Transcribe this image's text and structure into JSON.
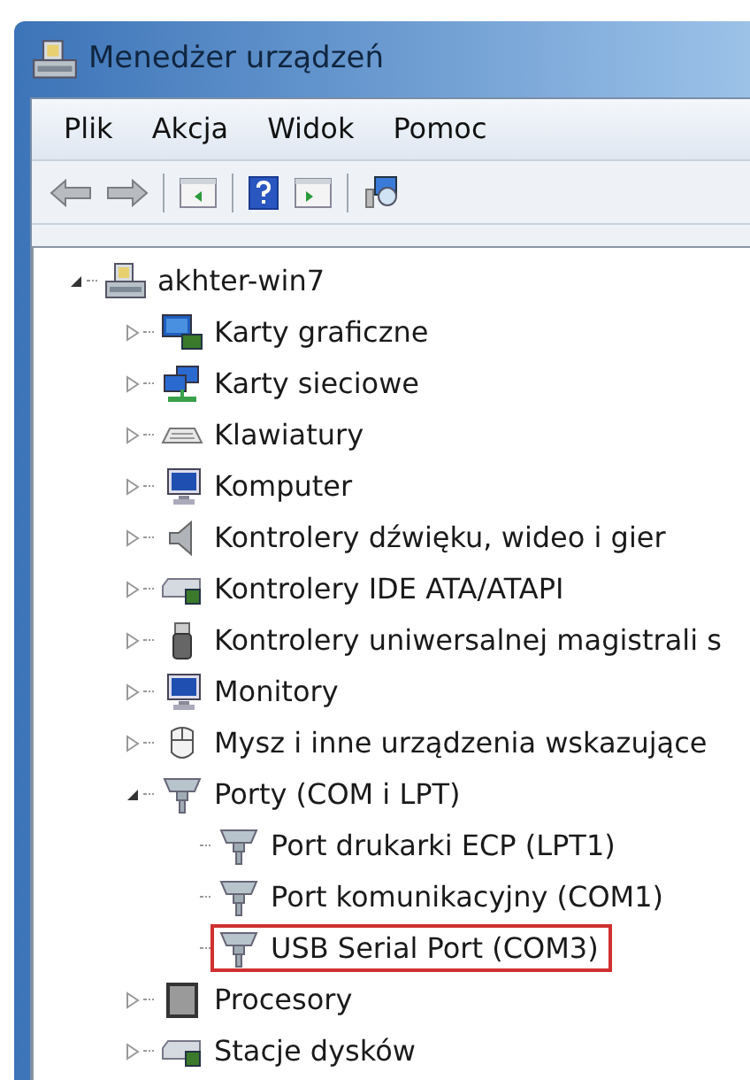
{
  "window": {
    "title": "Menedżer urządzeń"
  },
  "menu": [
    "Plik",
    "Akcja",
    "Widok",
    "Pomoc"
  ],
  "tree": [
    {
      "label": "akhter-win7",
      "kind": "computer",
      "expanded": true,
      "children": [
        {
          "label": "Karty graficzne",
          "kind": "display",
          "expanded": false
        },
        {
          "label": "Karty sieciowe",
          "kind": "network",
          "expanded": false
        },
        {
          "label": "Klawiatury",
          "kind": "keyboard",
          "expanded": false
        },
        {
          "label": "Komputer",
          "kind": "monitor",
          "expanded": false
        },
        {
          "label": "Kontrolery dźwięku, wideo i gier",
          "kind": "speaker",
          "expanded": false
        },
        {
          "label": "Kontrolery IDE ATA/ATAPI",
          "kind": "drive",
          "expanded": false
        },
        {
          "label": "Kontrolery uniwersalnej magistrali s",
          "kind": "usb",
          "expanded": false
        },
        {
          "label": "Monitory",
          "kind": "monitor",
          "expanded": false
        },
        {
          "label": "Mysz i inne urządzenia wskazujące",
          "kind": "mouse",
          "expanded": false
        },
        {
          "label": "Porty (COM i LPT)",
          "kind": "port",
          "expanded": true,
          "children": [
            {
              "label": "Port drukarki ECP (LPT1)",
              "kind": "port",
              "outlined": false
            },
            {
              "label": "Port komunikacyjny (COM1)",
              "kind": "port",
              "outlined": false
            },
            {
              "label": "USB Serial Port (COM3)",
              "kind": "port",
              "outlined": true
            }
          ]
        },
        {
          "label": "Procesory",
          "kind": "cpu",
          "expanded": false
        },
        {
          "label": "Stacje dysków",
          "kind": "drive",
          "expanded": false
        }
      ]
    }
  ]
}
